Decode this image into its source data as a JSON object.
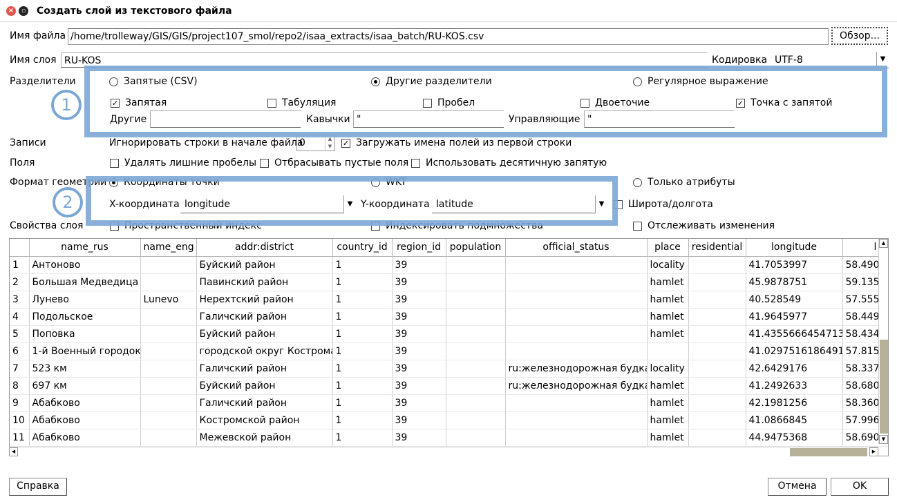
{
  "window": {
    "title": "Создать слой из текстового файла"
  },
  "file": {
    "label": "Имя файла",
    "path": "/home/trolleway/GIS/GIS/project107_smol/repo2/isaa_extracts/isaa_batch/RU-KOS.csv",
    "browse_label": "Обзор..."
  },
  "layer": {
    "label": "Имя слоя",
    "name": "RU-KOS",
    "encoding_label": "Кодировка",
    "encoding": "UTF-8"
  },
  "delimiters": {
    "label": "Разделители",
    "mode_csv": "Запятые (CSV)",
    "mode_custom": "Другие разделители",
    "mode_regex": "Регулярное выражение",
    "selected_mode": "custom",
    "comma": {
      "label": "Запятая",
      "checked": true
    },
    "tab": {
      "label": "Табуляция",
      "checked": false
    },
    "space": {
      "label": "Пробел",
      "checked": false
    },
    "colon": {
      "label": "Двоеточие",
      "checked": false
    },
    "semicolon": {
      "label": "Точка с запятой",
      "checked": true
    },
    "other_label": "Другие",
    "other_value": "",
    "quote_label": "Кавычки",
    "quote_value": "\"",
    "escape_label": "Управляющие",
    "escape_value": "\""
  },
  "records": {
    "label": "Записи",
    "skip_label": "Игнорировать строки в начале файла",
    "skip_value": "0",
    "header_label": "Загружать имена полей из первой строки",
    "header_checked": true
  },
  "fields": {
    "label": "Поля",
    "trim_label": "Удалять лишние пробелы",
    "discard_empty_label": "Отбрасывать пустые поля",
    "decimal_comma_label": "Использовать десятичную запятую"
  },
  "geometry": {
    "label": "Формат геометрии",
    "point_label": "Координаты точки",
    "wkt_label": "WKT",
    "attr_only_label": "Только атрибуты",
    "selected": "point",
    "x_label": "X-координата",
    "x_value": "longitude",
    "y_label": "Y-координата",
    "y_value": "latitude",
    "dms_label": "Широта/долгота"
  },
  "layer_props": {
    "label": "Свойства слоя",
    "spatial_index_label": "Пространственный индекс",
    "subset_index_label": "Индексировать подмножества",
    "watch_label": "Отслеживать изменения"
  },
  "annotations": {
    "badge1": "1",
    "badge2": "2"
  },
  "table": {
    "columns": [
      "name_rus",
      "name_eng",
      "addr:district",
      "country_id",
      "region_id",
      "population",
      "official_status",
      "place",
      "residential",
      "longitude",
      "l"
    ],
    "rows": [
      [
        "1",
        "Антоново",
        "",
        "Буйский район",
        "1",
        "39",
        "",
        "",
        "locality",
        "",
        "41.7053997",
        "58.490"
      ],
      [
        "2",
        "Большая Медведица",
        "",
        "Павинский район",
        "1",
        "39",
        "",
        "",
        "hamlet",
        "",
        "45.9878751",
        "59.135"
      ],
      [
        "3",
        "Лунево",
        "Lunevo",
        "Нерехтский район",
        "1",
        "39",
        "",
        "",
        "hamlet",
        "",
        "40.528549",
        "57.555"
      ],
      [
        "4",
        "Подольское",
        "",
        "Галичский район",
        "1",
        "39",
        "",
        "",
        "hamlet",
        "",
        "41.9645977",
        "58.449"
      ],
      [
        "5",
        "Поповка",
        "",
        "Буйский район",
        "1",
        "39",
        "",
        "",
        "hamlet",
        "",
        "41.4355666454713",
        "58.434"
      ],
      [
        "6",
        "1-й Военный городок",
        "",
        "городской округ Кострома",
        "1",
        "39",
        "",
        "",
        "",
        "",
        "41.0297516186491",
        "57.815"
      ],
      [
        "7",
        "523 км",
        "",
        "Галичский район",
        "1",
        "39",
        "",
        "ru:железнодорожная будка",
        "locality",
        "",
        "42.6429176",
        "58.337"
      ],
      [
        "8",
        "697 км",
        "",
        "Буйский район",
        "1",
        "39",
        "",
        "ru:железнодорожная будка",
        "hamlet",
        "",
        "41.2492633",
        "58.680"
      ],
      [
        "9",
        "Абабково",
        "",
        "Галичский район",
        "1",
        "39",
        "",
        "",
        "hamlet",
        "",
        "42.1981256",
        "58.360"
      ],
      [
        "10",
        "Абабково",
        "",
        "Костромской район",
        "1",
        "39",
        "",
        "",
        "hamlet",
        "",
        "41.0866845",
        "57.996"
      ],
      [
        "11",
        "Абабково",
        "",
        "Межевской район",
        "1",
        "39",
        "",
        "",
        "hamlet",
        "",
        "44.9475368",
        "58.690"
      ]
    ]
  },
  "buttons": {
    "help": "Справка",
    "cancel": "Отмена",
    "ok": "OK"
  }
}
